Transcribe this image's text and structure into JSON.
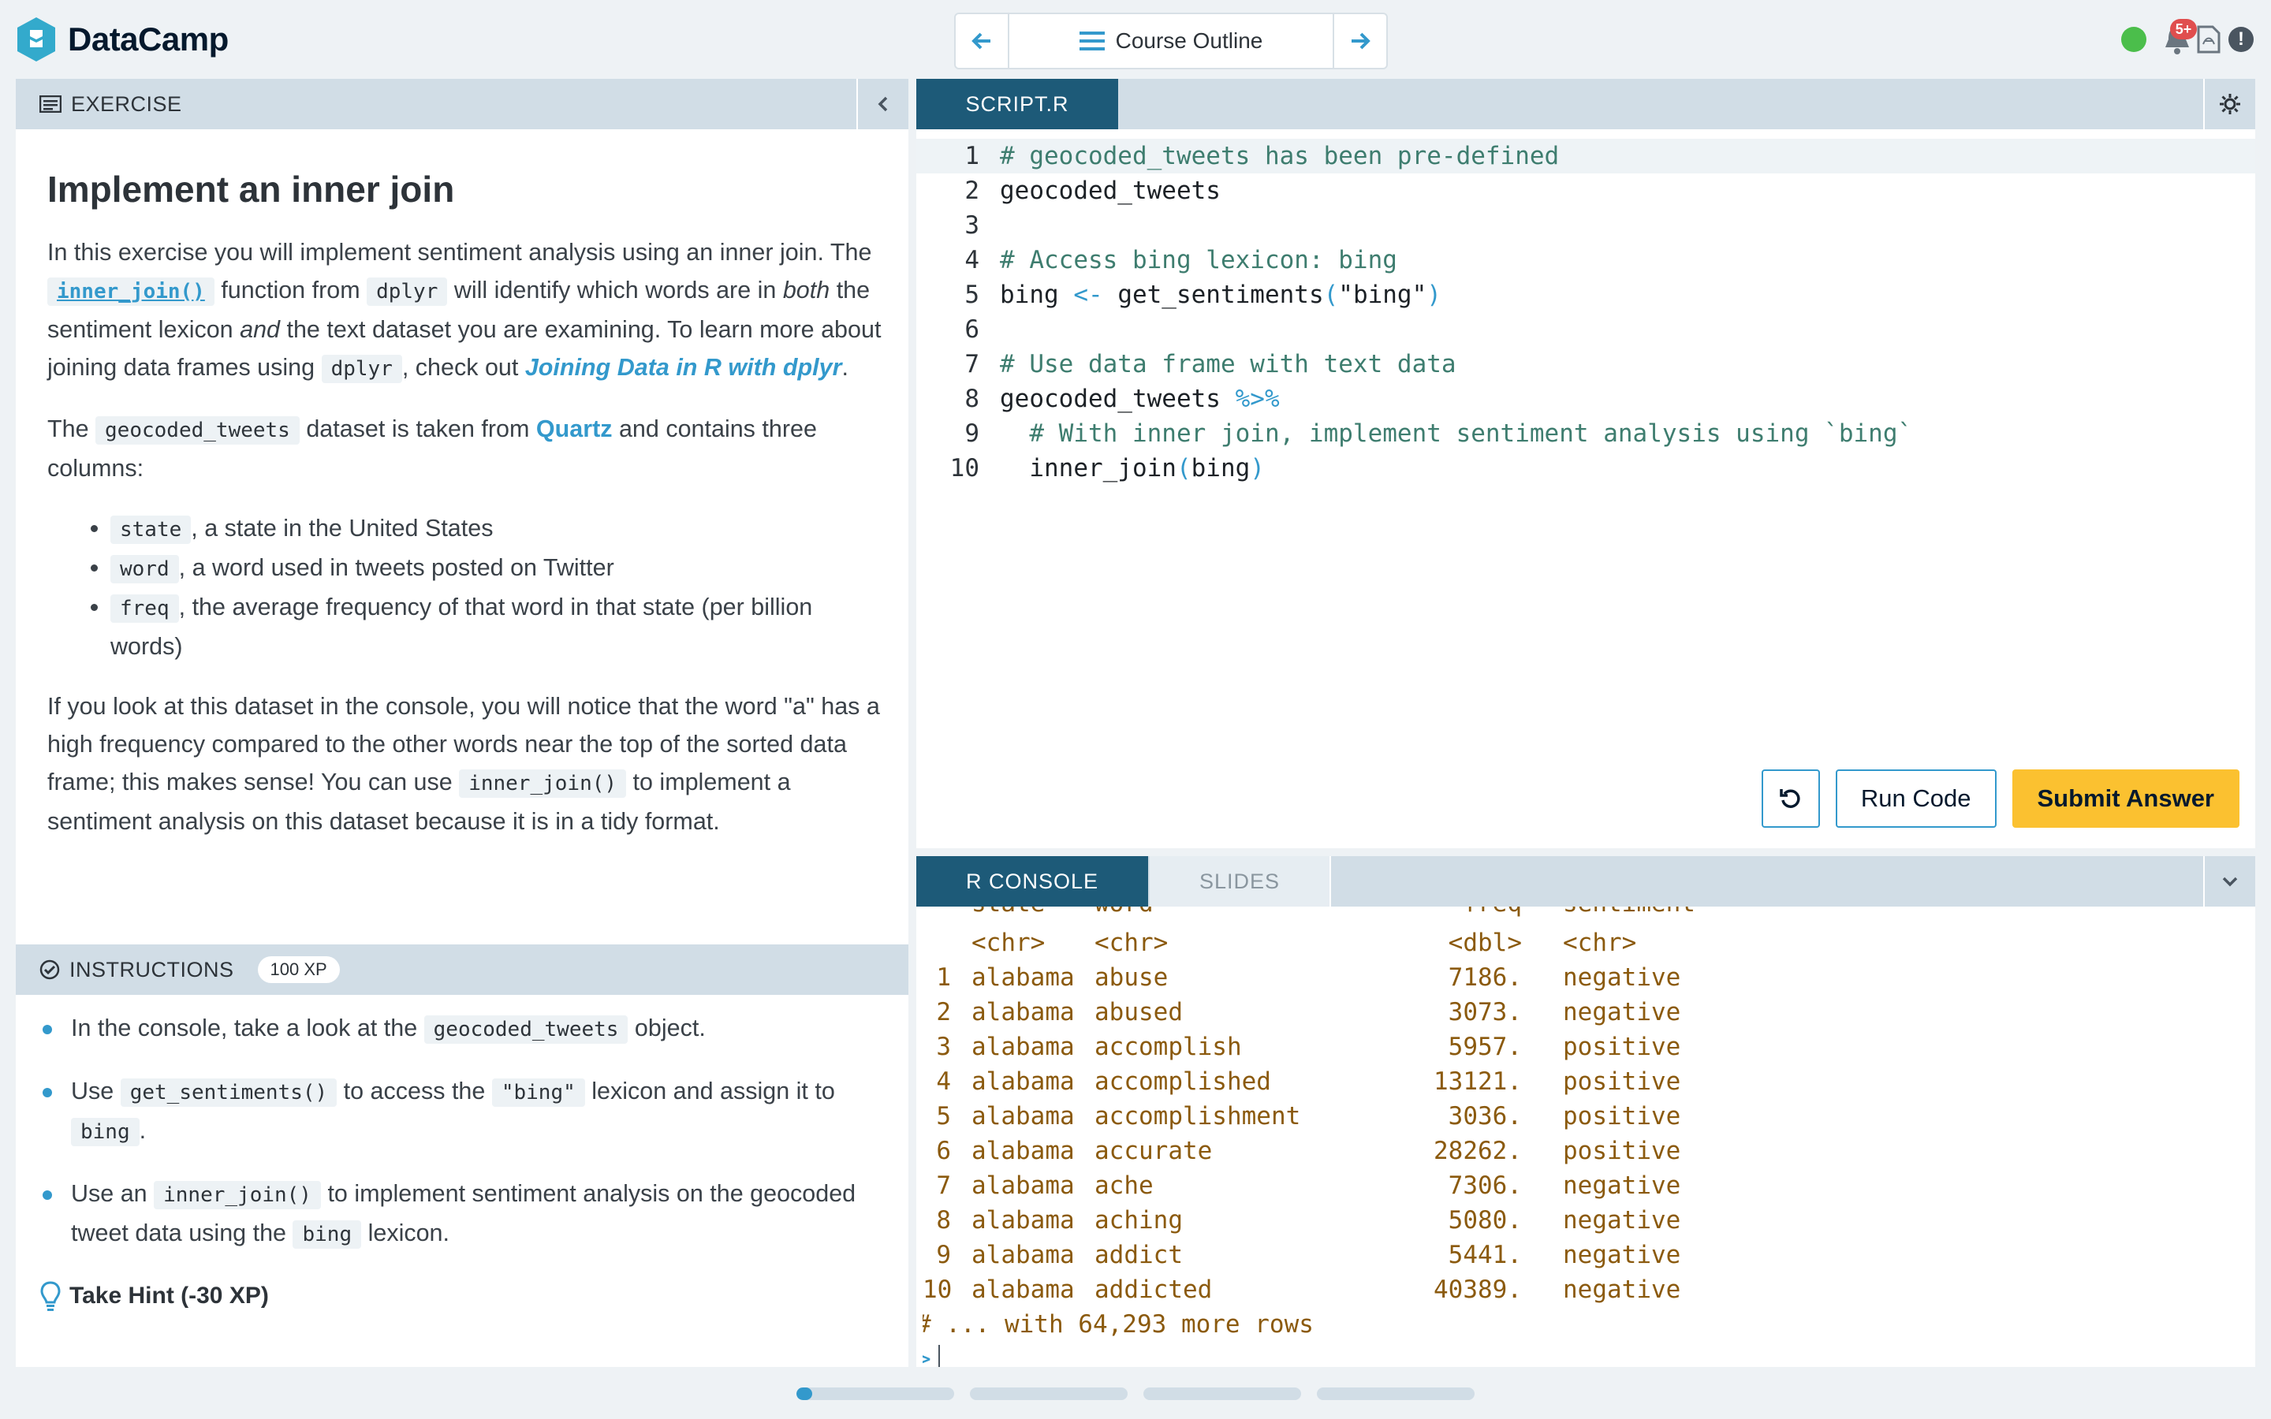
{
  "app": {
    "name": "DataCamp"
  },
  "nav": {
    "prev_label": "",
    "outline_label": "Course Outline",
    "next_label": ""
  },
  "notifications": {
    "badge": "5+"
  },
  "exercise": {
    "header": "Exercise",
    "title": "Implement an inner join",
    "p1": {
      "a": "In this exercise you will implement sentiment analysis using an inner join. The ",
      "code1": "inner_join()",
      "b": " function from ",
      "code2": "dplyr",
      "c": " will identify which words are in ",
      "em1": "both",
      "d": " the sentiment lexicon ",
      "em2": "and",
      "e": " the text dataset you are examining. To learn more about joining data frames using ",
      "code3": "dplyr",
      "f": ", check out ",
      "link": "Joining Data in R with dplyr",
      "g": "."
    },
    "p2": {
      "a": "The ",
      "code1": "geocoded_tweets",
      "b": " dataset is taken from ",
      "link": "Quartz",
      "c": " and contains three columns:"
    },
    "columns": [
      {
        "code": "state",
        "text": ", a state in the United States"
      },
      {
        "code": "word",
        "text": ", a word used in tweets posted on Twitter"
      },
      {
        "code": "freq",
        "text": ", the average frequency of that word in that state (per billion words)"
      }
    ],
    "p3": {
      "a": "If you look at this dataset in the console, you will notice that the word \"a\" has a high frequency compared to the other words near the top of the sorted data frame; this makes sense! You can use ",
      "code1": "inner_join()",
      "b": " to implement a sentiment analysis on this dataset because it is in a tidy format."
    }
  },
  "instructions": {
    "header": "Instructions",
    "xp": "100 XP",
    "i1": {
      "a": "In the console, take a look at the ",
      "code1": "geocoded_tweets",
      "b": " object."
    },
    "i2": {
      "a": "Use ",
      "code1": "get_sentiments()",
      "b": " to access the ",
      "code2": "\"bing\"",
      "c": " lexicon and assign it to ",
      "code3": "bing",
      "d": "."
    },
    "i3": {
      "a": "Use an ",
      "code1": "inner_join()",
      "b": " to implement sentiment analysis on the geocoded tweet data using the ",
      "code2": "bing",
      "c": " lexicon."
    },
    "hint": "Take Hint (-30 XP)"
  },
  "editor": {
    "tab": "SCRIPT.R",
    "lines": [
      {
        "n": "1",
        "comment": "# geocoded_tweets has been pre-defined"
      },
      {
        "n": "2",
        "code": "geocoded_tweets"
      },
      {
        "n": "3"
      },
      {
        "n": "4",
        "comment": "# Access bing lexicon: bing"
      },
      {
        "n": "5",
        "code": "bing",
        "op": " <- ",
        "fn": "get_sentiments",
        "open": "(",
        "str": "\"bing\"",
        "close": ")"
      },
      {
        "n": "6"
      },
      {
        "n": "7",
        "comment": "# Use data frame with text data"
      },
      {
        "n": "8",
        "code": "geocoded_tweets ",
        "op": "%>%"
      },
      {
        "n": "9",
        "comment": "  # With inner join, implement sentiment analysis using `bing`"
      },
      {
        "n": "10",
        "code": "  inner_join",
        "open": "(",
        "str": "bing",
        "close": ")"
      }
    ],
    "reset_label": "",
    "run_label": "Run Code",
    "submit_label": "Submit Answer"
  },
  "console": {
    "tab_console": "R CONSOLE",
    "tab_slides": "SLIDES",
    "header_cut": {
      "state": "state",
      "word": "word",
      "freq": "freq",
      "sent": "sentiment"
    },
    "types": {
      "state": "<chr>",
      "word": "<chr>",
      "freq": "<dbl>",
      "sent": "<chr>"
    },
    "rows": [
      {
        "i": "1",
        "state": "alabama",
        "word": "abuse",
        "freq": "7186.",
        "sent": "negative"
      },
      {
        "i": "2",
        "state": "alabama",
        "word": "abused",
        "freq": "3073.",
        "sent": "negative"
      },
      {
        "i": "3",
        "state": "alabama",
        "word": "accomplish",
        "freq": "5957.",
        "sent": "positive"
      },
      {
        "i": "4",
        "state": "alabama",
        "word": "accomplished",
        "freq": "13121.",
        "sent": "positive"
      },
      {
        "i": "5",
        "state": "alabama",
        "word": "accomplishment",
        "freq": "3036.",
        "sent": "positive"
      },
      {
        "i": "6",
        "state": "alabama",
        "word": "accurate",
        "freq": "28262.",
        "sent": "positive"
      },
      {
        "i": "7",
        "state": "alabama",
        "word": "ache",
        "freq": "7306.",
        "sent": "negative"
      },
      {
        "i": "8",
        "state": "alabama",
        "word": "aching",
        "freq": "5080.",
        "sent": "negative"
      },
      {
        "i": "9",
        "state": "alabama",
        "word": "addict",
        "freq": "5441.",
        "sent": "negative"
      },
      {
        "i": "10",
        "state": "alabama",
        "word": "addicted",
        "freq": "40389.",
        "sent": "negative"
      }
    ],
    "more": "# ... with 64,293 more rows",
    "prompt": ">"
  },
  "progress": {
    "segments": 4,
    "current_segment_fill": 0.1
  },
  "colors": {
    "accent": "#3399cc",
    "submit": "#fbc130",
    "tab_active": "#1d5a78",
    "status": "#4bbe4b"
  }
}
